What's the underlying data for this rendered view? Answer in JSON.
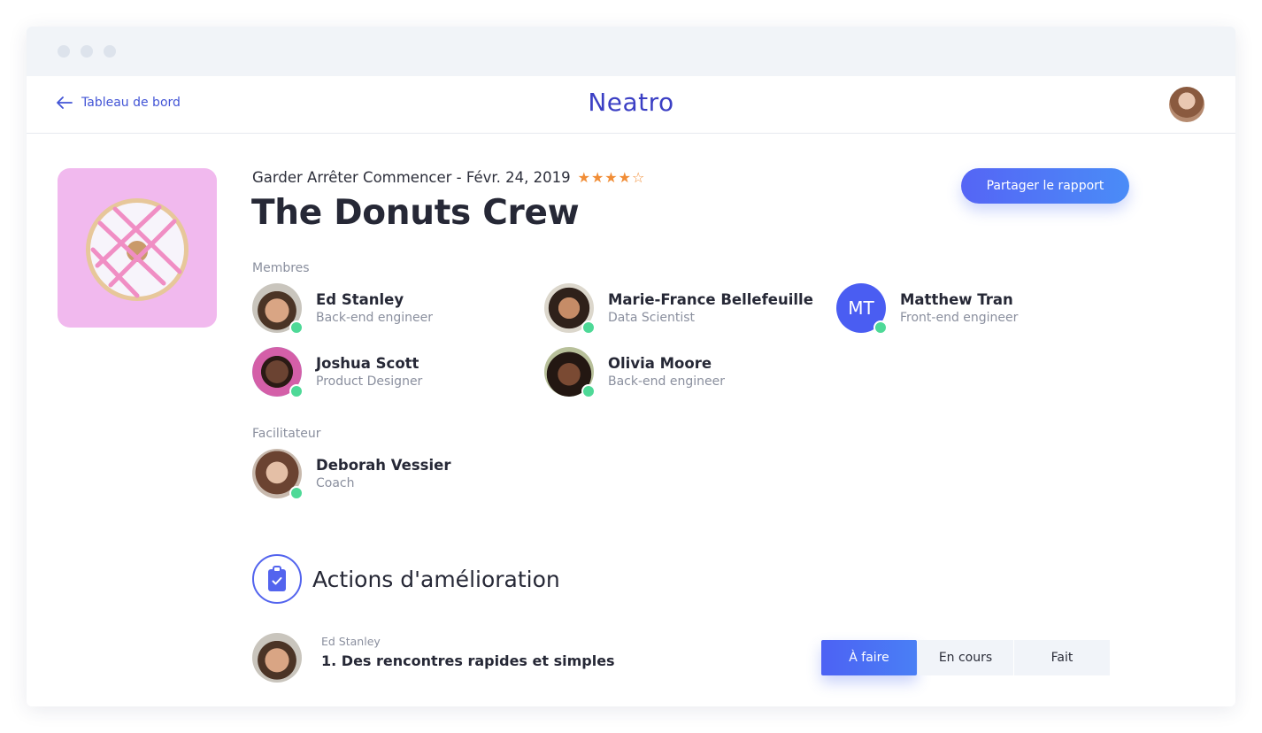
{
  "header": {
    "back_label": "Tableau de bord",
    "logo": "Neatro"
  },
  "board": {
    "meta": "Garder Arrêter Commencer - Févr. 24, 2019",
    "rating": 4,
    "rating_max": 5,
    "title": "The Donuts Crew",
    "share_label": "Partager le rapport"
  },
  "members": {
    "label": "Membres",
    "people": [
      {
        "name": "Ed Stanley",
        "role": "Back-end engineer"
      },
      {
        "name": "Marie-France Bellefeuille",
        "role": "Data Scientist"
      },
      {
        "name": "Matthew Tran",
        "role": "Front-end engineer",
        "initials": "MT"
      },
      {
        "name": "Joshua Scott",
        "role": "Product Designer"
      },
      {
        "name": "Olivia Moore",
        "role": "Back-end engineer"
      }
    ]
  },
  "facilitator": {
    "label": "Facilitateur",
    "name": "Deborah Vessier",
    "role": "Coach"
  },
  "actions": {
    "title": "Actions d'amélioration",
    "items": [
      {
        "owner": "Ed Stanley",
        "text": "1. Des rencontres rapides et simples",
        "status": "À faire"
      }
    ],
    "status_options": [
      "À faire",
      "En cours",
      "Fait"
    ]
  },
  "colors": {
    "accent": "#4a5df2",
    "online": "#4ed997",
    "star": "#f18d36",
    "hero_bg": "#f1b9ee"
  },
  "icons": [
    "arrow-left-icon",
    "star-icon",
    "clipboard-check-icon"
  ]
}
